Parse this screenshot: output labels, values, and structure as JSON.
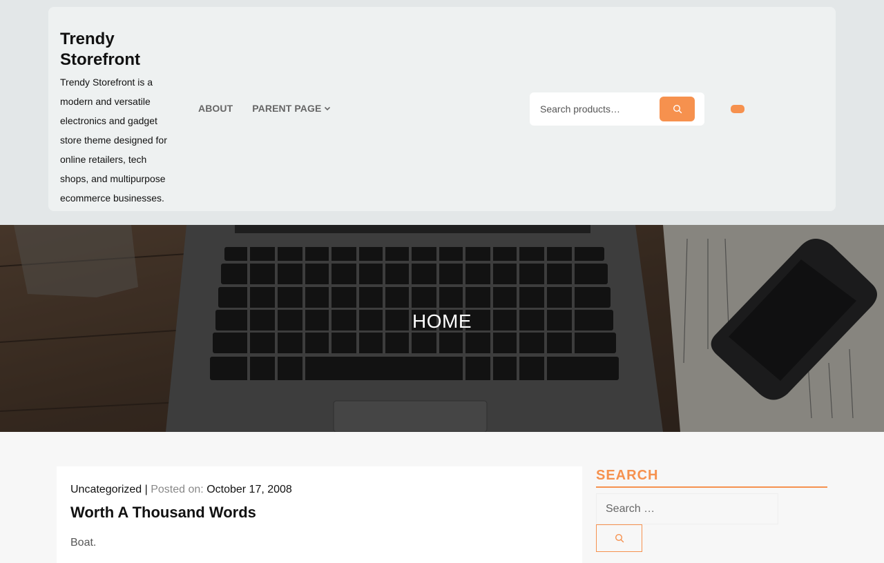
{
  "site": {
    "title": "Trendy Storefront",
    "tagline": "Trendy Storefront is a modern and versatile electronics and gadget store theme designed for online retailers, tech shops, and multipurpose ecommerce businesses."
  },
  "nav": {
    "items": [
      {
        "label": "ABOUT"
      },
      {
        "label": "PARENT PAGE"
      }
    ]
  },
  "header_search": {
    "placeholder": "Search products…",
    "button_icon": "search-icon"
  },
  "hero": {
    "title": "HOME"
  },
  "post": {
    "category": "Uncategorized",
    "separator": "|",
    "posted_label": "Posted on:",
    "date": "October 17, 2008",
    "title": "Worth A Thousand Words",
    "excerpt": "Boat."
  },
  "sidebar": {
    "search_title": "SEARCH",
    "search_placeholder": "Search …",
    "search_button_icon": "search-icon"
  },
  "colors": {
    "accent": "#f6914e",
    "header_bg": "#eef1f1",
    "page_bg": "#f7f7f7"
  }
}
